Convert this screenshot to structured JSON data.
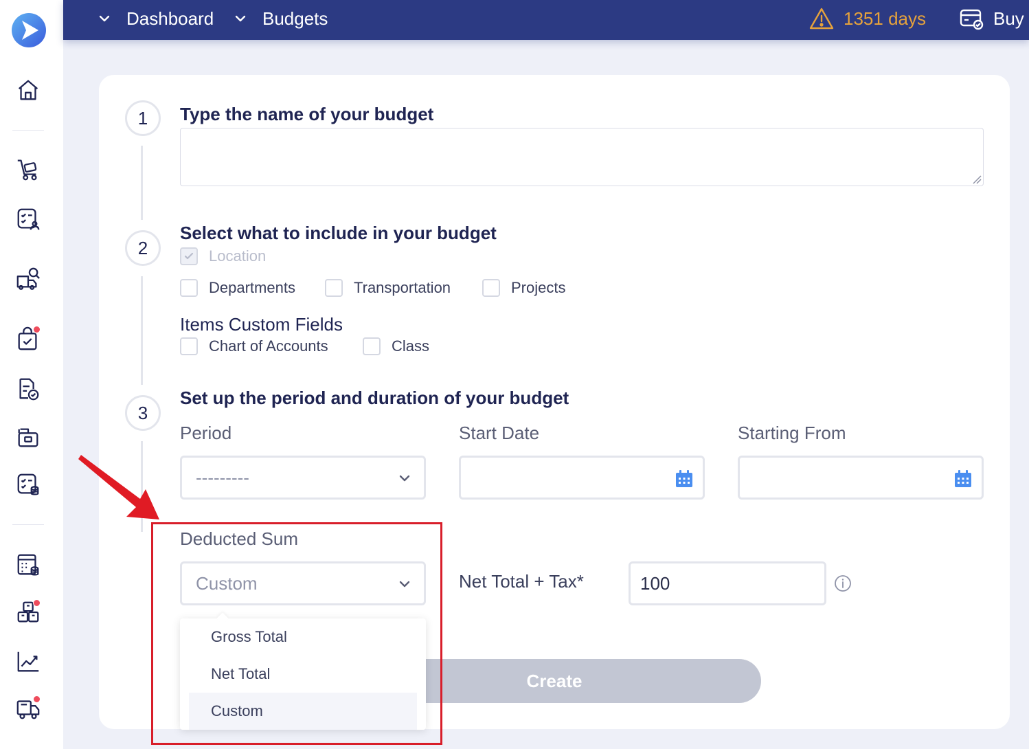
{
  "colors": {
    "topbar": "#2c3a83",
    "warning": "#e6a23c",
    "create_disabled": "#c2c6d3",
    "highlight": "#d81e2a",
    "notification_dot": "#ef4c5c"
  },
  "topbar": {
    "breadcrumbs": [
      "Dashboard",
      "Budgets"
    ],
    "trial_days": "1351 days",
    "buy_label": "Buy"
  },
  "sidebar": {
    "icons": [
      "home-icon",
      "cart-icon",
      "checklist-user-icon",
      "truck-search-icon",
      "shopping-bag-check-icon",
      "document-check-icon",
      "box-icon",
      "checklist-database-icon",
      "calculator-database-icon",
      "boxes-icon",
      "chart-line-icon",
      "truck-icon"
    ]
  },
  "steps": {
    "step1": {
      "number": "1",
      "title": "Type the name of your budget",
      "name_value": ""
    },
    "step2": {
      "number": "2",
      "title": "Select what to include in your budget",
      "location": "Location",
      "include_options": [
        "Departments",
        "Transportation",
        "Projects"
      ],
      "custom_fields_title": "Items Custom Fields",
      "custom_fields": [
        "Chart of Accounts",
        "Class"
      ]
    },
    "step3": {
      "number": "3",
      "title": "Set up the period and duration of your budget",
      "period_label": "Period",
      "period_value": "---------",
      "start_date_label": "Start Date",
      "starting_from_label": "Starting From"
    }
  },
  "deducted": {
    "label": "Deducted Sum",
    "value": "Custom",
    "options": [
      "Gross Total",
      "Net Total",
      "Custom"
    ],
    "selected": "Custom",
    "net_label": "Net Total + Tax*",
    "net_value": "100"
  },
  "actions": {
    "create_label": "Create"
  }
}
